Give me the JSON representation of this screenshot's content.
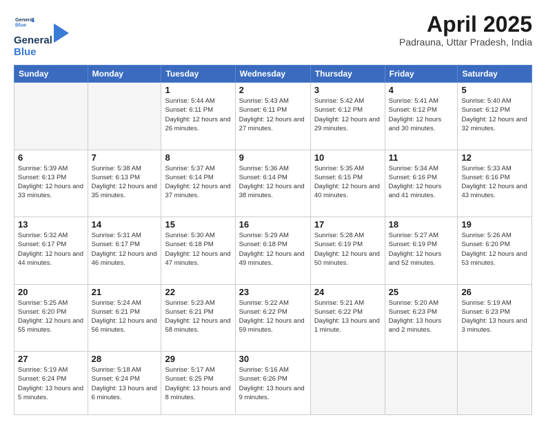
{
  "logo": {
    "line1": "General",
    "line2": "Blue"
  },
  "title": "April 2025",
  "location": "Padrauna, Uttar Pradesh, India",
  "days_of_week": [
    "Sunday",
    "Monday",
    "Tuesday",
    "Wednesday",
    "Thursday",
    "Friday",
    "Saturday"
  ],
  "weeks": [
    [
      {
        "num": "",
        "info": ""
      },
      {
        "num": "",
        "info": ""
      },
      {
        "num": "1",
        "info": "Sunrise: 5:44 AM\nSunset: 6:11 PM\nDaylight: 12 hours and 26 minutes."
      },
      {
        "num": "2",
        "info": "Sunrise: 5:43 AM\nSunset: 6:11 PM\nDaylight: 12 hours and 27 minutes."
      },
      {
        "num": "3",
        "info": "Sunrise: 5:42 AM\nSunset: 6:12 PM\nDaylight: 12 hours and 29 minutes."
      },
      {
        "num": "4",
        "info": "Sunrise: 5:41 AM\nSunset: 6:12 PM\nDaylight: 12 hours and 30 minutes."
      },
      {
        "num": "5",
        "info": "Sunrise: 5:40 AM\nSunset: 6:12 PM\nDaylight: 12 hours and 32 minutes."
      }
    ],
    [
      {
        "num": "6",
        "info": "Sunrise: 5:39 AM\nSunset: 6:13 PM\nDaylight: 12 hours and 33 minutes."
      },
      {
        "num": "7",
        "info": "Sunrise: 5:38 AM\nSunset: 6:13 PM\nDaylight: 12 hours and 35 minutes."
      },
      {
        "num": "8",
        "info": "Sunrise: 5:37 AM\nSunset: 6:14 PM\nDaylight: 12 hours and 37 minutes."
      },
      {
        "num": "9",
        "info": "Sunrise: 5:36 AM\nSunset: 6:14 PM\nDaylight: 12 hours and 38 minutes."
      },
      {
        "num": "10",
        "info": "Sunrise: 5:35 AM\nSunset: 6:15 PM\nDaylight: 12 hours and 40 minutes."
      },
      {
        "num": "11",
        "info": "Sunrise: 5:34 AM\nSunset: 6:16 PM\nDaylight: 12 hours and 41 minutes."
      },
      {
        "num": "12",
        "info": "Sunrise: 5:33 AM\nSunset: 6:16 PM\nDaylight: 12 hours and 43 minutes."
      }
    ],
    [
      {
        "num": "13",
        "info": "Sunrise: 5:32 AM\nSunset: 6:17 PM\nDaylight: 12 hours and 44 minutes."
      },
      {
        "num": "14",
        "info": "Sunrise: 5:31 AM\nSunset: 6:17 PM\nDaylight: 12 hours and 46 minutes."
      },
      {
        "num": "15",
        "info": "Sunrise: 5:30 AM\nSunset: 6:18 PM\nDaylight: 12 hours and 47 minutes."
      },
      {
        "num": "16",
        "info": "Sunrise: 5:29 AM\nSunset: 6:18 PM\nDaylight: 12 hours and 49 minutes."
      },
      {
        "num": "17",
        "info": "Sunrise: 5:28 AM\nSunset: 6:19 PM\nDaylight: 12 hours and 50 minutes."
      },
      {
        "num": "18",
        "info": "Sunrise: 5:27 AM\nSunset: 6:19 PM\nDaylight: 12 hours and 52 minutes."
      },
      {
        "num": "19",
        "info": "Sunrise: 5:26 AM\nSunset: 6:20 PM\nDaylight: 12 hours and 53 minutes."
      }
    ],
    [
      {
        "num": "20",
        "info": "Sunrise: 5:25 AM\nSunset: 6:20 PM\nDaylight: 12 hours and 55 minutes."
      },
      {
        "num": "21",
        "info": "Sunrise: 5:24 AM\nSunset: 6:21 PM\nDaylight: 12 hours and 56 minutes."
      },
      {
        "num": "22",
        "info": "Sunrise: 5:23 AM\nSunset: 6:21 PM\nDaylight: 12 hours and 58 minutes."
      },
      {
        "num": "23",
        "info": "Sunrise: 5:22 AM\nSunset: 6:22 PM\nDaylight: 12 hours and 59 minutes."
      },
      {
        "num": "24",
        "info": "Sunrise: 5:21 AM\nSunset: 6:22 PM\nDaylight: 13 hours and 1 minute."
      },
      {
        "num": "25",
        "info": "Sunrise: 5:20 AM\nSunset: 6:23 PM\nDaylight: 13 hours and 2 minutes."
      },
      {
        "num": "26",
        "info": "Sunrise: 5:19 AM\nSunset: 6:23 PM\nDaylight: 13 hours and 3 minutes."
      }
    ],
    [
      {
        "num": "27",
        "info": "Sunrise: 5:19 AM\nSunset: 6:24 PM\nDaylight: 13 hours and 5 minutes."
      },
      {
        "num": "28",
        "info": "Sunrise: 5:18 AM\nSunset: 6:24 PM\nDaylight: 13 hours and 6 minutes."
      },
      {
        "num": "29",
        "info": "Sunrise: 5:17 AM\nSunset: 6:25 PM\nDaylight: 13 hours and 8 minutes."
      },
      {
        "num": "30",
        "info": "Sunrise: 5:16 AM\nSunset: 6:26 PM\nDaylight: 13 hours and 9 minutes."
      },
      {
        "num": "",
        "info": ""
      },
      {
        "num": "",
        "info": ""
      },
      {
        "num": "",
        "info": ""
      }
    ]
  ]
}
